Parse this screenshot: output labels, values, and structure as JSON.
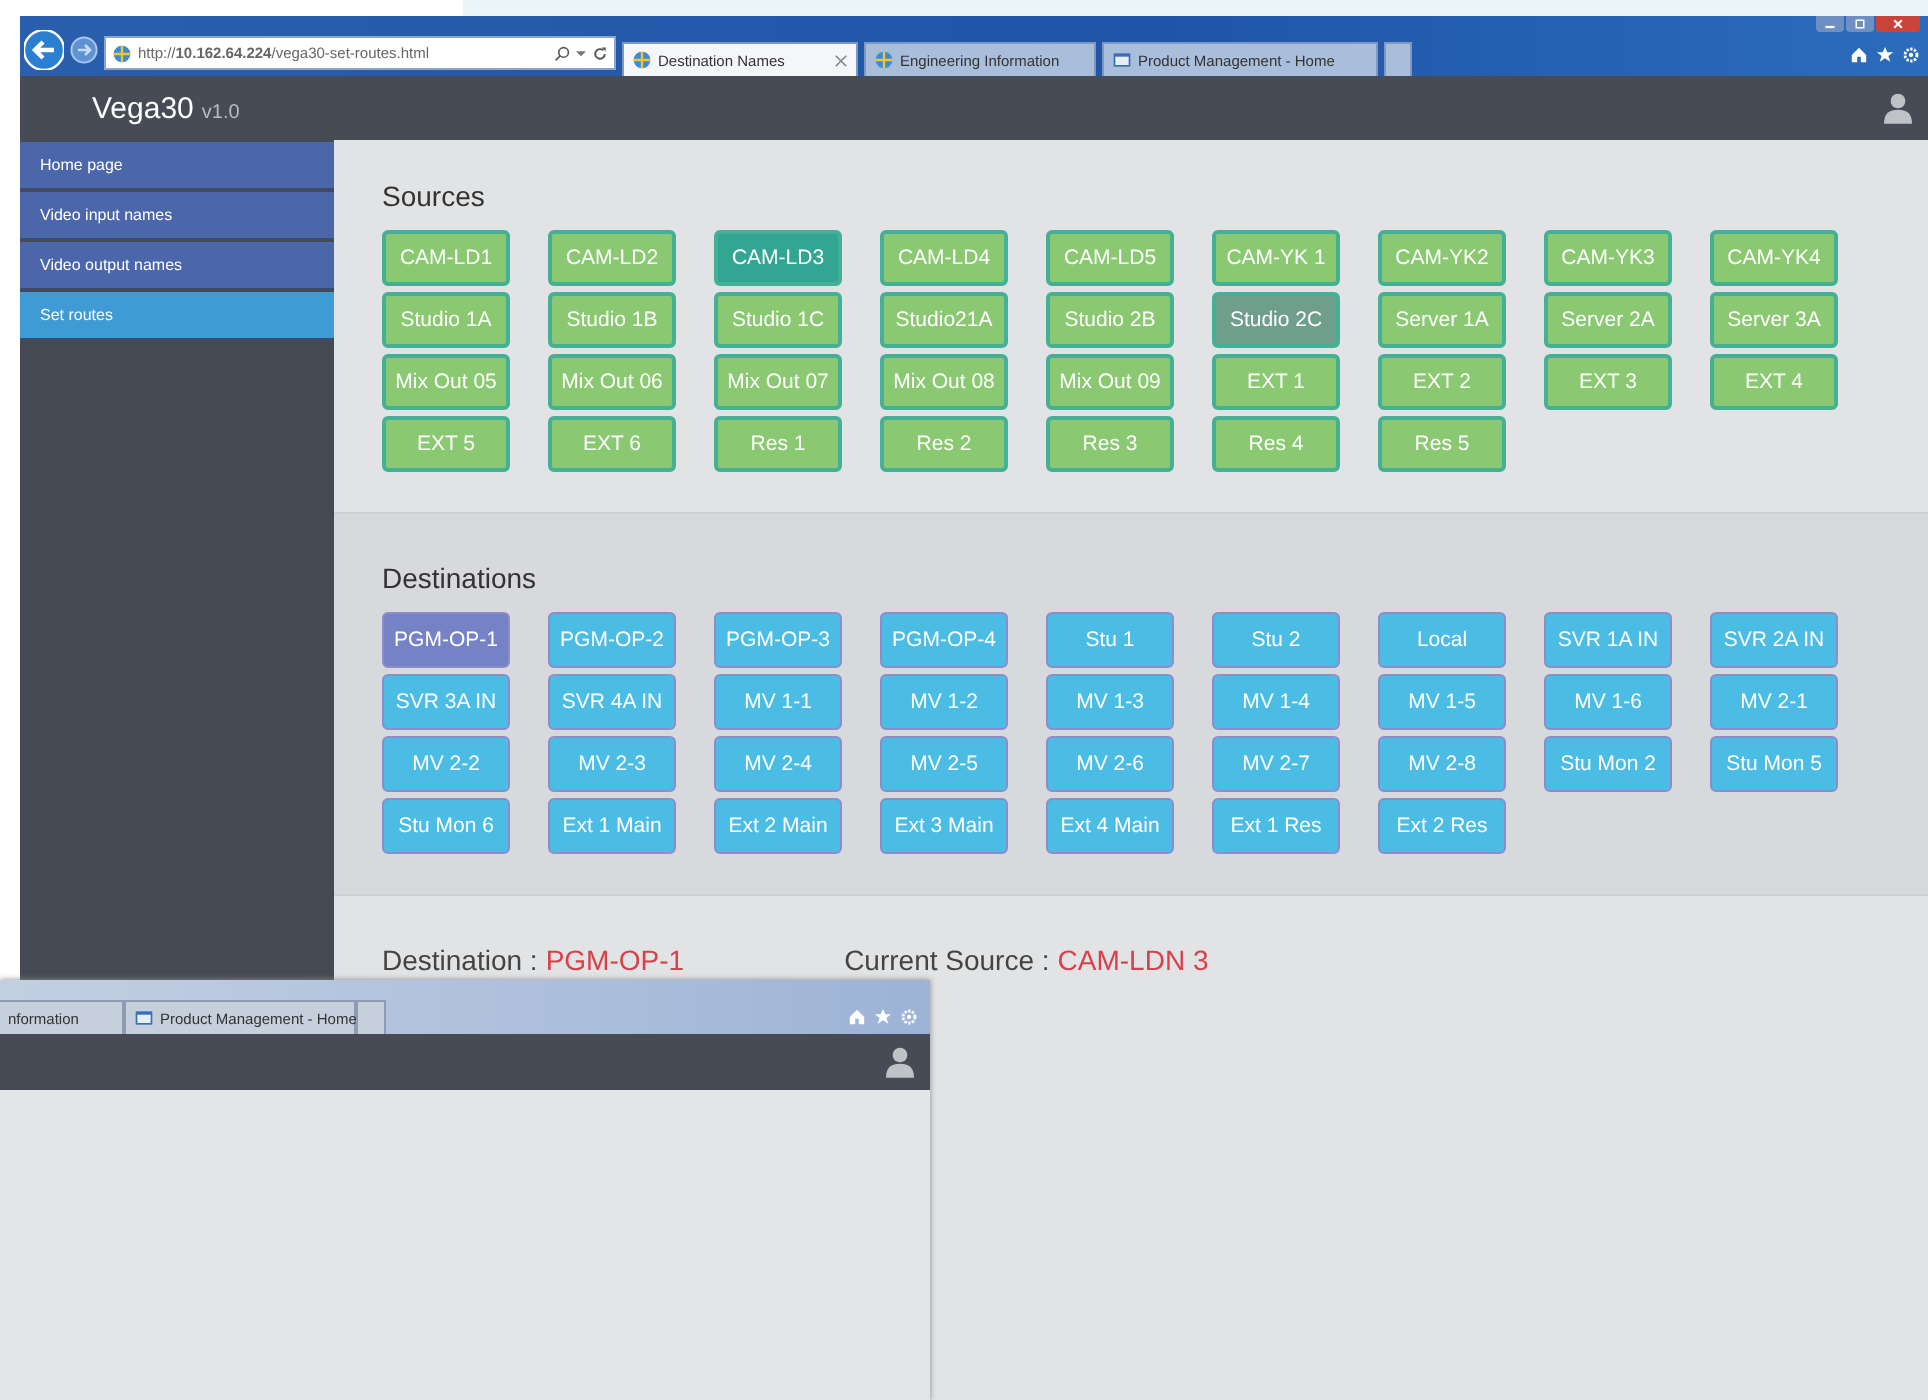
{
  "browser": {
    "address": "http://**10.162.64.224**/vega30-set-routes.html",
    "tabs": [
      {
        "label": "Destination Names",
        "kind": "web",
        "selected": true
      },
      {
        "label": "Engineering Information",
        "kind": "web",
        "selected": false
      },
      {
        "label": "Product Management - Home",
        "kind": "app",
        "selected": false
      }
    ]
  },
  "app": {
    "title": "Vega30",
    "version": "v1.0",
    "sidebar": [
      {
        "label": "Home page",
        "selected": false
      },
      {
        "label": "Video input names",
        "selected": false
      },
      {
        "label": "Video output names",
        "selected": false
      },
      {
        "label": "Set routes",
        "selected": true
      }
    ],
    "sources": {
      "heading": "Sources",
      "buttons": [
        {
          "label": "CAM-LD1",
          "selected": false,
          "hovered": false
        },
        {
          "label": "CAM-LD2",
          "selected": false,
          "hovered": false
        },
        {
          "label": "CAM-LD3",
          "selected": true,
          "hovered": false
        },
        {
          "label": "CAM-LD4",
          "selected": false,
          "hovered": false
        },
        {
          "label": "CAM-LD5",
          "selected": false,
          "hovered": false
        },
        {
          "label": "CAM-YK 1",
          "selected": false,
          "hovered": false
        },
        {
          "label": "CAM-YK2",
          "selected": false,
          "hovered": false
        },
        {
          "label": "CAM-YK3",
          "selected": false,
          "hovered": false
        },
        {
          "label": "CAM-YK4",
          "selected": false,
          "hovered": false
        },
        {
          "label": "Studio 1A",
          "selected": false,
          "hovered": false
        },
        {
          "label": "Studio 1B",
          "selected": false,
          "hovered": false
        },
        {
          "label": "Studio 1C",
          "selected": false,
          "hovered": false
        },
        {
          "label": "Studio21A",
          "selected": false,
          "hovered": false
        },
        {
          "label": "Studio 2B",
          "selected": false,
          "hovered": false
        },
        {
          "label": "Studio 2C",
          "selected": false,
          "hovered": true
        },
        {
          "label": "Server 1A",
          "selected": false,
          "hovered": false
        },
        {
          "label": "Server 2A",
          "selected": false,
          "hovered": false
        },
        {
          "label": "Server 3A",
          "selected": false,
          "hovered": false
        },
        {
          "label": "Mix Out 05",
          "selected": false,
          "hovered": false
        },
        {
          "label": "Mix Out 06",
          "selected": false,
          "hovered": false
        },
        {
          "label": "Mix Out 07",
          "selected": false,
          "hovered": false
        },
        {
          "label": "Mix Out 08",
          "selected": false,
          "hovered": false
        },
        {
          "label": "Mix Out 09",
          "selected": false,
          "hovered": false
        },
        {
          "label": "EXT 1",
          "selected": false,
          "hovered": false
        },
        {
          "label": "EXT 2",
          "selected": false,
          "hovered": false
        },
        {
          "label": "EXT 3",
          "selected": false,
          "hovered": false
        },
        {
          "label": "EXT 4",
          "selected": false,
          "hovered": false
        },
        {
          "label": "EXT 5",
          "selected": false,
          "hovered": false
        },
        {
          "label": "EXT 6",
          "selected": false,
          "hovered": false
        },
        {
          "label": "Res 1",
          "selected": false,
          "hovered": false
        },
        {
          "label": "Res 2",
          "selected": false,
          "hovered": false
        },
        {
          "label": "Res 3",
          "selected": false,
          "hovered": false
        },
        {
          "label": "Res 4",
          "selected": false,
          "hovered": false
        },
        {
          "label": "Res 5",
          "selected": false,
          "hovered": false
        }
      ]
    },
    "destinations": {
      "heading": "Destinations",
      "buttons": [
        {
          "label": "PGM-OP-1",
          "selected": true
        },
        {
          "label": "PGM-OP-2",
          "selected": false
        },
        {
          "label": "PGM-OP-3",
          "selected": false
        },
        {
          "label": "PGM-OP-4",
          "selected": false
        },
        {
          "label": "Stu 1",
          "selected": false
        },
        {
          "label": "Stu 2",
          "selected": false
        },
        {
          "label": "Local",
          "selected": false
        },
        {
          "label": "SVR 1A IN",
          "selected": false
        },
        {
          "label": "SVR 2A IN",
          "selected": false
        },
        {
          "label": "SVR 3A IN",
          "selected": false
        },
        {
          "label": "SVR 4A IN",
          "selected": false
        },
        {
          "label": "MV 1-1",
          "selected": false
        },
        {
          "label": "MV 1-2",
          "selected": false
        },
        {
          "label": "MV 1-3",
          "selected": false
        },
        {
          "label": "MV 1-4",
          "selected": false
        },
        {
          "label": "MV 1-5",
          "selected": false
        },
        {
          "label": "MV 1-6",
          "selected": false
        },
        {
          "label": "MV 2-1",
          "selected": false
        },
        {
          "label": "MV 2-2",
          "selected": false
        },
        {
          "label": "MV 2-3",
          "selected": false
        },
        {
          "label": "MV 2-4",
          "selected": false
        },
        {
          "label": "MV 2-5",
          "selected": false
        },
        {
          "label": "MV 2-6",
          "selected": false
        },
        {
          "label": "MV 2-7",
          "selected": false
        },
        {
          "label": "MV 2-8",
          "selected": false
        },
        {
          "label": "Stu Mon 2",
          "selected": false
        },
        {
          "label": "Stu Mon 5",
          "selected": false
        },
        {
          "label": "Stu Mon 6",
          "selected": false
        },
        {
          "label": "Ext 1 Main",
          "selected": false
        },
        {
          "label": "Ext 2 Main",
          "selected": false
        },
        {
          "label": "Ext 3 Main",
          "selected": false
        },
        {
          "label": "Ext 4 Main",
          "selected": false
        },
        {
          "label": "Ext 1 Res",
          "selected": false
        },
        {
          "label": "Ext 2 Res",
          "selected": false
        }
      ]
    },
    "status": [
      {
        "label": "Destination :",
        "value": "PGM-OP-1"
      },
      {
        "label": "Current Source :",
        "value": "CAM-LDN 3"
      }
    ]
  },
  "second_window": {
    "tabs": [
      {
        "label": "nformation",
        "kind": "plain"
      },
      {
        "label": "Product Management - Home",
        "kind": "app"
      }
    ]
  }
}
